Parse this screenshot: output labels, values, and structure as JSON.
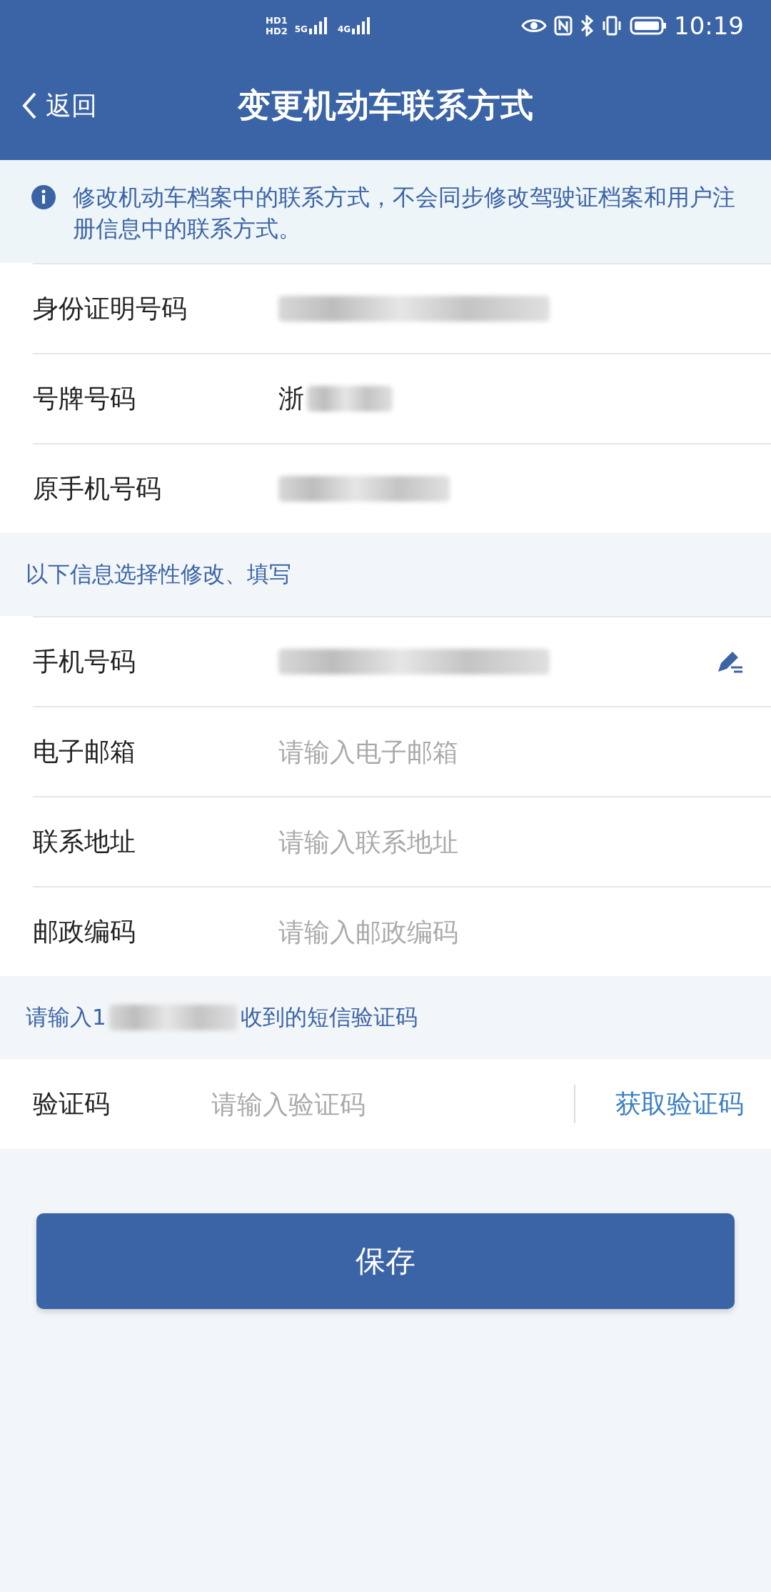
{
  "status_bar": {
    "sim_labels": [
      "HD1",
      "HD2"
    ],
    "networks": [
      "5G",
      "4G"
    ],
    "time": "10:19"
  },
  "nav": {
    "back": "返回",
    "title": "变更机动车联系方式"
  },
  "notice": "修改机动车档案中的联系方式，不会同步修改驾驶证档案和用户注册信息中的联系方式。",
  "fixed_rows": [
    {
      "label": "身份证明号码",
      "value": "",
      "redacted": true,
      "editable": false
    },
    {
      "label": "号牌号码",
      "value": "浙",
      "redacted": true,
      "editable": false
    },
    {
      "label": "原手机号码",
      "value": "",
      "redacted": true,
      "editable": false
    }
  ],
  "optional_label": "以下信息选择性修改、填写",
  "optional_rows": [
    {
      "label": "手机号码",
      "value": "",
      "redacted": true,
      "editable": true
    },
    {
      "label": "电子邮箱",
      "placeholder": "请输入电子邮箱",
      "redacted": false,
      "editable": false
    },
    {
      "label": "联系地址",
      "placeholder": "请输入联系地址",
      "redacted": false,
      "editable": false
    },
    {
      "label": "邮政编码",
      "placeholder": "请输入邮政编码",
      "redacted": false,
      "editable": false
    }
  ],
  "sms_hint": {
    "prefix": "请输入1",
    "suffix": "收到的短信验证码",
    "redacted": true
  },
  "code_row": {
    "label": "验证码",
    "placeholder": "请输入验证码",
    "action": "获取验证码"
  },
  "save_button": "保存"
}
